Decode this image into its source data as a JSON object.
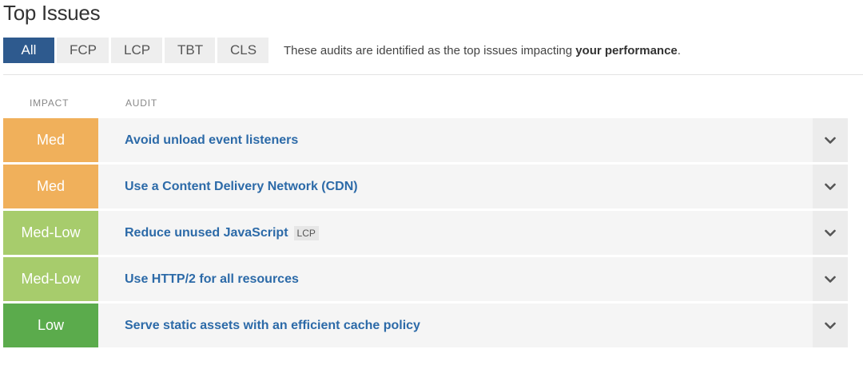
{
  "page": {
    "title": "Top Issues"
  },
  "tabs": {
    "items": [
      {
        "label": "All",
        "active": true
      },
      {
        "label": "FCP",
        "active": false
      },
      {
        "label": "LCP",
        "active": false
      },
      {
        "label": "TBT",
        "active": false
      },
      {
        "label": "CLS",
        "active": false
      }
    ],
    "description_prefix": "These audits are identified as the top issues impacting ",
    "description_bold": "your performance",
    "description_suffix": "."
  },
  "table": {
    "headers": {
      "impact": "IMPACT",
      "audit": "AUDIT"
    },
    "rows": [
      {
        "impact": "Med",
        "impact_color": "#f0b05b",
        "audit": "Avoid unload event listeners",
        "tag": ""
      },
      {
        "impact": "Med",
        "impact_color": "#f0b05b",
        "audit": "Use a Content Delivery Network (CDN)",
        "tag": ""
      },
      {
        "impact": "Med-Low",
        "impact_color": "#a7cc6c",
        "audit": "Reduce unused JavaScript",
        "tag": "LCP"
      },
      {
        "impact": "Med-Low",
        "impact_color": "#a7cc6c",
        "audit": "Use HTTP/2 for all resources",
        "tag": ""
      },
      {
        "impact": "Low",
        "impact_color": "#5bab4c",
        "audit": "Serve static assets with an efficient cache policy",
        "tag": ""
      }
    ]
  },
  "icons": {
    "expander": "chevron-down-icon"
  },
  "colors": {
    "tab_active": "#2e5a8e",
    "audit_link": "#2c6aa8"
  }
}
